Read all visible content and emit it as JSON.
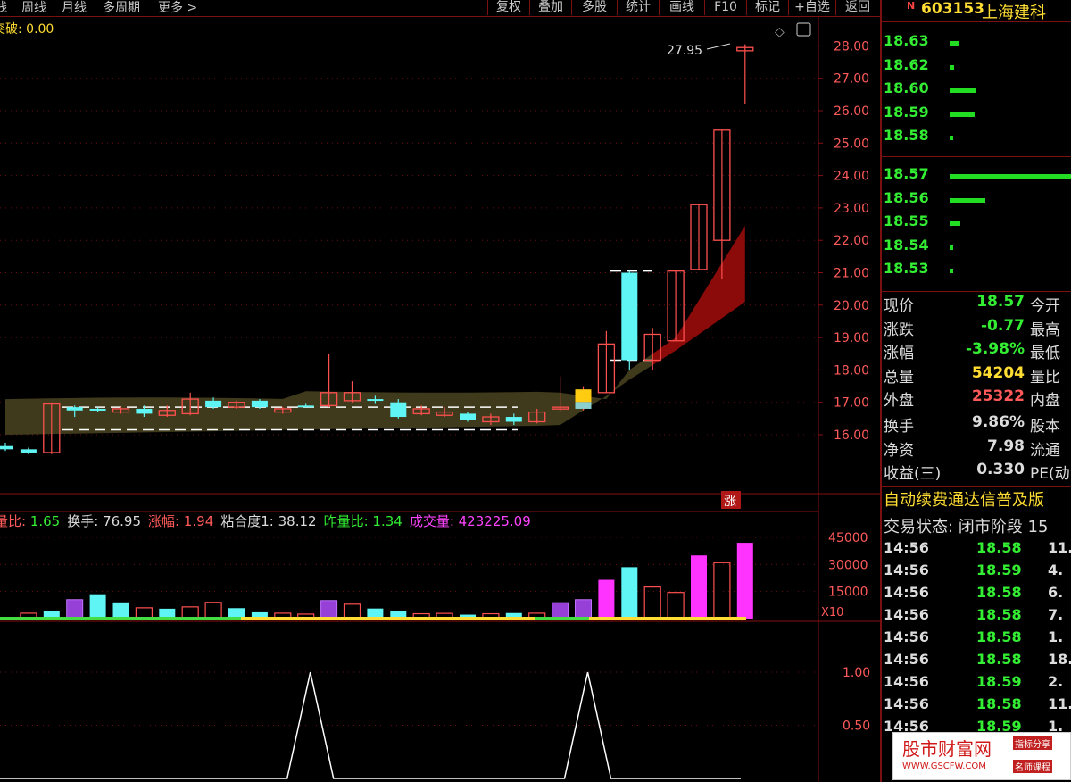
{
  "topbar": {
    "left_items": [
      "线",
      "周线",
      "月线",
      "多周期",
      "更多 >"
    ],
    "right_buttons": [
      "复权",
      "叠加",
      "多股",
      "统计",
      "画线",
      "F10",
      "标记",
      "+自选",
      "返回"
    ]
  },
  "main": {
    "indicator_label": "突破: 0.00",
    "max_price_label": "27.95",
    "price_axis": [
      "28.00",
      "27.00",
      "26.00",
      "25.00",
      "24.00",
      "23.00",
      "22.00",
      "21.00",
      "20.00",
      "19.00",
      "18.00",
      "17.00",
      "16.00"
    ],
    "limit_badge": "涨"
  },
  "volume": {
    "header": [
      {
        "label": "量比: ",
        "value": "1.65",
        "label_color": "#ff5a5a",
        "value_color": "#33ee33"
      },
      {
        "label": "换手: ",
        "value": "76.95",
        "label_color": "#dddddd",
        "value_color": "#dddddd"
      },
      {
        "label": "涨幅: ",
        "value": "1.94",
        "label_color": "#ff5a5a",
        "value_color": "#ff5a5a"
      },
      {
        "label": "粘合度1: ",
        "value": "38.12",
        "label_color": "#dddddd",
        "value_color": "#dddddd"
      },
      {
        "label": "昨量比: ",
        "value": "1.34",
        "label_color": "#33ee33",
        "value_color": "#33ee33"
      },
      {
        "label": "成交量: ",
        "value": "423225.09",
        "label_color": "#ff44ff",
        "value_color": "#ff44ff"
      }
    ],
    "axis": [
      "45000",
      "30000",
      "15000"
    ],
    "unit": "X10"
  },
  "lower": {
    "axis": [
      "1.00",
      "0.50"
    ]
  },
  "quote": {
    "code": "603153",
    "name": "上海建科",
    "marker": "N",
    "ask": [
      {
        "price": "18.63",
        "bar": 10
      },
      {
        "price": "18.62",
        "bar": 5
      },
      {
        "price": "18.60",
        "bar": 30
      },
      {
        "price": "18.59",
        "bar": 28
      },
      {
        "price": "18.58",
        "bar": 4
      }
    ],
    "bid": [
      {
        "price": "18.57",
        "bar": 140
      },
      {
        "price": "18.56",
        "bar": 40
      },
      {
        "price": "18.55",
        "bar": 12
      },
      {
        "price": "18.54",
        "bar": 4
      },
      {
        "price": "18.53",
        "bar": 4
      }
    ],
    "info1": [
      {
        "label": "现价",
        "value": "18.57",
        "color": "#33ee33",
        "label2": "今开"
      },
      {
        "label": "涨跌",
        "value": "-0.77",
        "color": "#33ee33",
        "label2": "最高"
      },
      {
        "label": "涨幅",
        "value": "-3.98%",
        "color": "#33ee33",
        "label2": "最低"
      },
      {
        "label": "总量",
        "value": "54204",
        "color": "#ffdd33",
        "label2": "量比"
      },
      {
        "label": "外盘",
        "value": "25322",
        "color": "#ff5a5a",
        "label2": "内盘"
      }
    ],
    "info2": [
      {
        "label": "换手",
        "value": "9.86%",
        "color": "#dddddd",
        "label2": "股本"
      },
      {
        "label": "净资",
        "value": "7.98",
        "color": "#dddddd",
        "label2": "流通"
      },
      {
        "label": "收益(三)",
        "value": "0.330",
        "color": "#dddddd",
        "label2": "PE(动"
      }
    ],
    "banner": "自动续费通达信普及版",
    "trade_status": "交易状态: 闭市阶段 15",
    "ticks": [
      {
        "time": "14:56",
        "price": "18.58",
        "vol": "11."
      },
      {
        "time": "14:56",
        "price": "18.59",
        "vol": "4."
      },
      {
        "time": "14:56",
        "price": "18.58",
        "vol": "6."
      },
      {
        "time": "14:56",
        "price": "18.58",
        "vol": "7."
      },
      {
        "time": "14:56",
        "price": "18.58",
        "vol": "1."
      },
      {
        "time": "14:56",
        "price": "18.58",
        "vol": "18."
      },
      {
        "time": "14:56",
        "price": "18.59",
        "vol": "2."
      },
      {
        "time": "14:56",
        "price": "18.58",
        "vol": "11."
      },
      {
        "time": "14:56",
        "price": "18.59",
        "vol": "1."
      }
    ],
    "watermark": {
      "name": "股市财富网",
      "url": "WWW.GSCFW.COM",
      "tag1": "指标分享",
      "tag2": "名师课程"
    }
  },
  "chart_data": {
    "type": "candlestick",
    "price_ylim": [
      15.3,
      28.3
    ],
    "candles": [
      [
        15.65,
        15.55,
        15.75,
        15.5
      ],
      [
        15.55,
        15.45,
        15.6,
        15.4
      ],
      [
        15.45,
        16.95,
        17.0,
        15.4
      ],
      [
        16.85,
        16.75,
        16.9,
        16.55
      ],
      [
        16.8,
        16.75,
        16.85,
        16.7
      ],
      [
        16.7,
        16.8,
        16.85,
        16.65
      ],
      [
        16.8,
        16.65,
        16.9,
        16.55
      ],
      [
        16.6,
        16.75,
        16.9,
        16.55
      ],
      [
        16.65,
        17.1,
        17.3,
        16.6
      ],
      [
        17.05,
        16.85,
        17.15,
        16.8
      ],
      [
        16.85,
        17.0,
        17.05,
        16.8
      ],
      [
        17.05,
        16.85,
        17.1,
        16.8
      ],
      [
        16.7,
        16.8,
        16.85,
        16.65
      ],
      [
        16.9,
        16.88,
        16.95,
        16.85
      ],
      [
        16.9,
        17.3,
        18.5,
        16.85
      ],
      [
        17.05,
        17.3,
        17.65,
        17.0
      ],
      [
        17.1,
        17.05,
        17.2,
        16.95
      ],
      [
        17.0,
        16.55,
        17.1,
        16.5
      ],
      [
        16.65,
        16.8,
        16.9,
        16.6
      ],
      [
        16.6,
        16.7,
        16.85,
        16.55
      ],
      [
        16.65,
        16.45,
        16.7,
        16.4
      ],
      [
        16.4,
        16.55,
        16.65,
        16.3
      ],
      [
        16.55,
        16.4,
        16.65,
        16.3
      ],
      [
        16.4,
        16.7,
        16.8,
        16.35
      ],
      [
        16.8,
        16.85,
        17.8,
        16.7
      ],
      [
        16.8,
        17.4,
        17.5,
        16.75
      ],
      [
        17.3,
        18.8,
        19.2,
        17.3
      ],
      [
        21.0,
        18.3,
        21.05,
        18.0
      ],
      [
        18.3,
        19.1,
        19.3,
        18.0
      ],
      [
        18.9,
        21.05,
        21.05,
        18.9
      ],
      [
        21.1,
        23.1,
        23.1,
        21.1
      ],
      [
        22.0,
        25.4,
        25.4,
        20.8
      ],
      [
        27.85,
        27.95,
        28.05,
        26.2
      ]
    ],
    "volume_ylim": [
      0,
      46000
    ],
    "volume": [
      [
        3000,
        "r"
      ],
      [
        4000,
        "c"
      ],
      [
        10500,
        "p"
      ],
      [
        13500,
        "c"
      ],
      [
        9000,
        "c"
      ],
      [
        6000,
        "r"
      ],
      [
        5500,
        "c"
      ],
      [
        6500,
        "r"
      ],
      [
        9000,
        "r"
      ],
      [
        5800,
        "c"
      ],
      [
        3500,
        "c"
      ],
      [
        3000,
        "r"
      ],
      [
        2500,
        "r"
      ],
      [
        10000,
        "p"
      ],
      [
        8000,
        "r"
      ],
      [
        5600,
        "c"
      ],
      [
        4300,
        "c"
      ],
      [
        2700,
        "r"
      ],
      [
        2900,
        "r"
      ],
      [
        2200,
        "c"
      ],
      [
        2700,
        "r"
      ],
      [
        3100,
        "c"
      ],
      [
        3000,
        "r"
      ],
      [
        8800,
        "p"
      ],
      [
        10500,
        "p"
      ],
      [
        21500,
        "m"
      ],
      [
        28500,
        "c"
      ],
      [
        17500,
        "r"
      ],
      [
        14500,
        "r"
      ],
      [
        35000,
        "m"
      ],
      [
        31000,
        "r"
      ],
      [
        42000,
        "m"
      ]
    ],
    "signal_ylim": [
      0,
      1.3
    ],
    "signal_peaks": [
      13,
      25
    ]
  }
}
